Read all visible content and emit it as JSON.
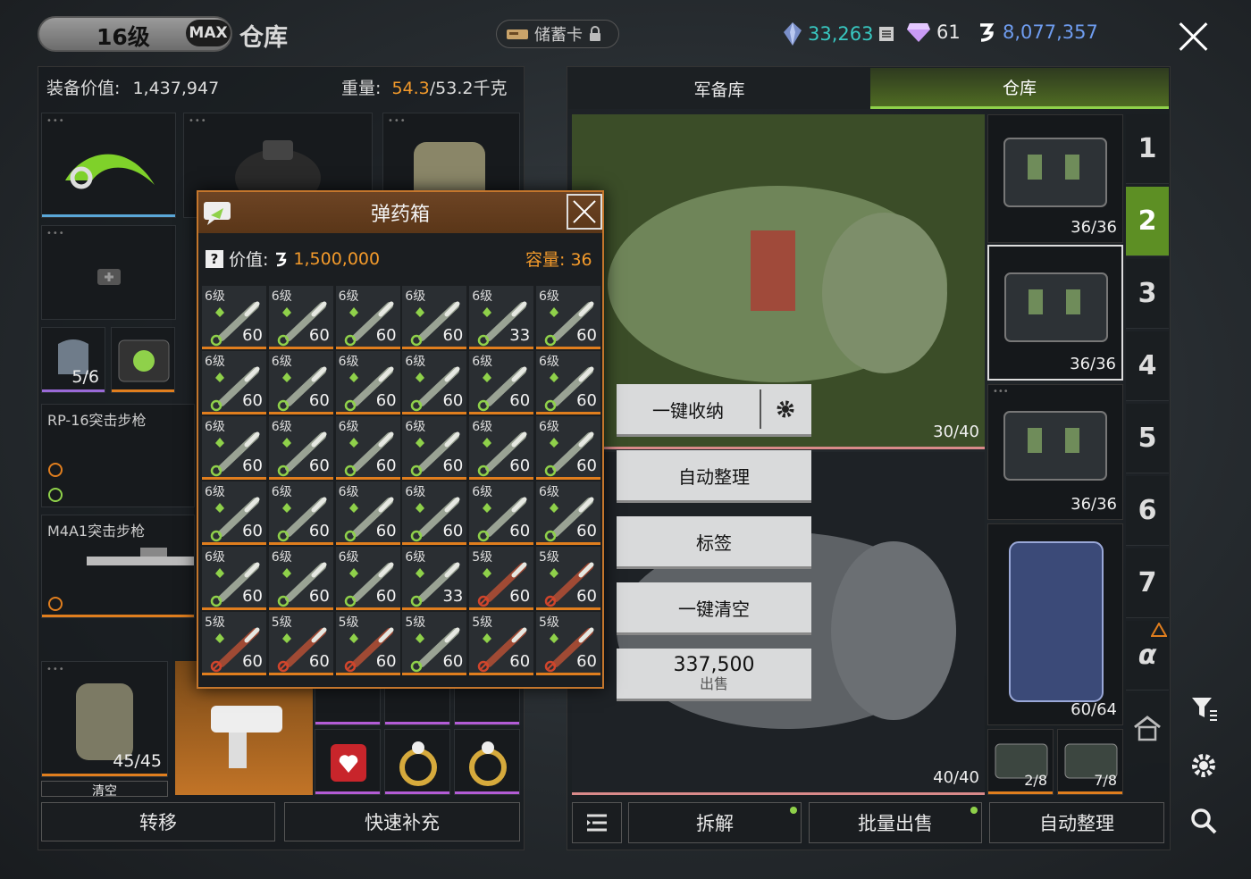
{
  "header": {
    "level": "16级",
    "max_badge": "MAX",
    "title": "仓库",
    "card_label": "储蓄卡",
    "currency1": "33,263",
    "currency2": "61",
    "currency3": "8,077,357"
  },
  "left": {
    "equip_label": "装备价值:",
    "equip_value": "1,437,947",
    "weight_label": "重量:",
    "weight_current": "54.3",
    "weight_rest": "/53.2千克",
    "armor_count": "5/6",
    "gun1_name": "RP-16突击步枪",
    "gun2_name": "M4A1突击步枪",
    "backpack_count": "45/45",
    "clear_partial": "清空",
    "btn_transfer": "转移",
    "btn_refill": "快速补充"
  },
  "right": {
    "tab1": "军备库",
    "tab2": "仓库",
    "bagA_count": "30/40",
    "bagB_count": "40/40",
    "side_counts": [
      "36/36",
      "36/36",
      "36/36",
      "60/64",
      "2/8",
      "7/8"
    ],
    "num_tabs": [
      "1",
      "2",
      "3",
      "4",
      "5",
      "6",
      "7",
      "α"
    ],
    "menu_store": "一键收纳",
    "menu_sort": "自动整理",
    "menu_tag": "标签",
    "menu_clear": "一键清空",
    "sell_price": "337,500",
    "sell_label": "出售",
    "btn_dismantle": "拆解",
    "btn_bulk_sell": "批量出售",
    "btn_auto_sort": "自动整理"
  },
  "popup": {
    "title": "弹药箱",
    "value_label": "价值:",
    "value": "1,500,000",
    "capacity": "容量: 36",
    "items": [
      {
        "grade": "6级",
        "qty": "60",
        "type": "green"
      },
      {
        "grade": "6级",
        "qty": "60",
        "type": "green"
      },
      {
        "grade": "6级",
        "qty": "60",
        "type": "green"
      },
      {
        "grade": "6级",
        "qty": "60",
        "type": "green"
      },
      {
        "grade": "6级",
        "qty": "33",
        "type": "green"
      },
      {
        "grade": "6级",
        "qty": "60",
        "type": "green"
      },
      {
        "grade": "6级",
        "qty": "60",
        "type": "green"
      },
      {
        "grade": "6级",
        "qty": "60",
        "type": "green"
      },
      {
        "grade": "6级",
        "qty": "60",
        "type": "green"
      },
      {
        "grade": "6级",
        "qty": "60",
        "type": "green"
      },
      {
        "grade": "6级",
        "qty": "60",
        "type": "green"
      },
      {
        "grade": "6级",
        "qty": "60",
        "type": "green"
      },
      {
        "grade": "6级",
        "qty": "60",
        "type": "green"
      },
      {
        "grade": "6级",
        "qty": "60",
        "type": "green"
      },
      {
        "grade": "6级",
        "qty": "60",
        "type": "green"
      },
      {
        "grade": "6级",
        "qty": "60",
        "type": "green"
      },
      {
        "grade": "6级",
        "qty": "60",
        "type": "green"
      },
      {
        "grade": "6级",
        "qty": "60",
        "type": "green"
      },
      {
        "grade": "6级",
        "qty": "60",
        "type": "green"
      },
      {
        "grade": "6级",
        "qty": "60",
        "type": "green"
      },
      {
        "grade": "6级",
        "qty": "60",
        "type": "green"
      },
      {
        "grade": "6级",
        "qty": "60",
        "type": "green"
      },
      {
        "grade": "6级",
        "qty": "60",
        "type": "green"
      },
      {
        "grade": "6级",
        "qty": "60",
        "type": "green"
      },
      {
        "grade": "6级",
        "qty": "60",
        "type": "green"
      },
      {
        "grade": "6级",
        "qty": "60",
        "type": "green"
      },
      {
        "grade": "6级",
        "qty": "60",
        "type": "green"
      },
      {
        "grade": "6级",
        "qty": "33",
        "type": "green"
      },
      {
        "grade": "5级",
        "qty": "60",
        "type": "red"
      },
      {
        "grade": "5级",
        "qty": "60",
        "type": "red"
      },
      {
        "grade": "5级",
        "qty": "60",
        "type": "red"
      },
      {
        "grade": "5级",
        "qty": "60",
        "type": "red"
      },
      {
        "grade": "5级",
        "qty": "60",
        "type": "red"
      },
      {
        "grade": "5级",
        "qty": "60",
        "type": "green"
      },
      {
        "grade": "5级",
        "qty": "60",
        "type": "red"
      },
      {
        "grade": "5级",
        "qty": "60",
        "type": "red"
      }
    ]
  },
  "colors": {
    "accent_green": "#8fd14a",
    "accent_orange": "#e07e1e",
    "weight_warn": "#f39a2b",
    "cyan": "#38c7c0",
    "blue": "#6f9df0"
  }
}
